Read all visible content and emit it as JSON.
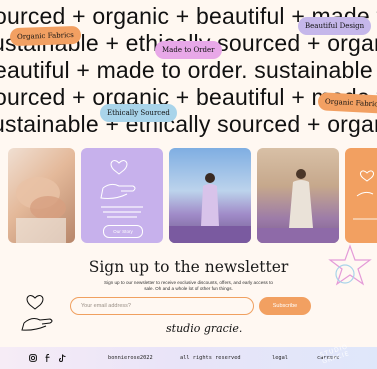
{
  "marquee": {
    "lines": [
      "ourced + organic + beautiful + made to order",
      "ustainable + ethically sourced + organic",
      "eautiful + made to order. sustainable + ethically",
      "ourced + organic + beautiful + made to order",
      "ustainable + ethically sourced + organic"
    ],
    "tags": [
      {
        "label": "Organic Fabrics",
        "color": "#f2a062"
      },
      {
        "label": "Beautiful Design",
        "color": "#c5b7ea"
      },
      {
        "label": "Made to Order",
        "color": "#e8a8e8"
      },
      {
        "label": "Ethically Sourced",
        "color": "#a9d4ea"
      },
      {
        "label": "Organic Fabrics",
        "color": "#f2a062"
      }
    ]
  },
  "gallery": {
    "card_button": "Our Story"
  },
  "newsletter": {
    "title": "Sign up to the newsletter",
    "description": "Sign up to our newsletter to receive exclusive discounts, offers, and early access to sale. Oh and a whole lot of other fun things.",
    "email_placeholder": "Your email address?",
    "subscribe_label": "Subscribe",
    "signature": "studio gracie."
  },
  "footer": {
    "handle": "bonnierose2022",
    "rights": "all rights reserved",
    "legal": "legal",
    "careers": "careers",
    "stamp": "STUDIO GRACIE"
  },
  "colors": {
    "accent_orange": "#f2a061",
    "lilac": "#c5b7ea",
    "background": "#fff8f2"
  }
}
